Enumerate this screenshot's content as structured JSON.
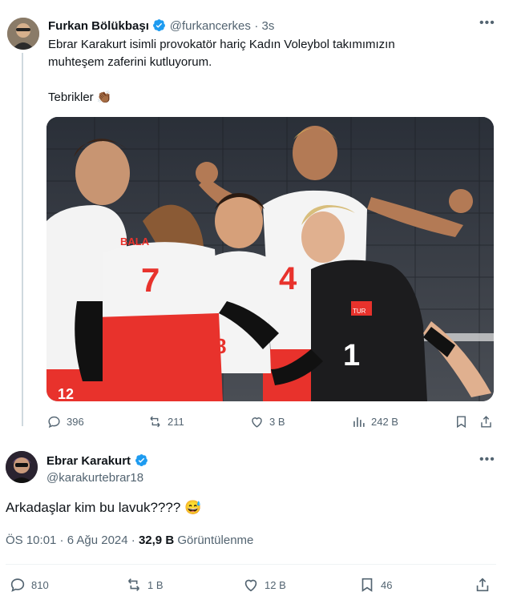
{
  "quoted_tweet": {
    "author_name": "Furkan Bölükbaşı",
    "handle": "@furkancerkes",
    "time": "· 3s",
    "text_line1": "Ebrar Karakurt isimli provokatör hariç Kadın Voleybol takımımızın",
    "text_line2": "muhteşem zaferini kutluyorum.",
    "text_line3": "Tebrikler",
    "emoji": "👏🏾",
    "jersey_numbers": [
      "7",
      "4",
      "1",
      "8",
      "12"
    ],
    "jersey_text": "BALA",
    "flag_text": "TUR",
    "actions": {
      "replies": "396",
      "retweets": "211",
      "likes": "3 B",
      "views": "242 B"
    }
  },
  "main_tweet": {
    "author_name": "Ebrar Karakurt",
    "handle": "@karakurtebrar18",
    "text": "Arkadaşlar kim bu lavuk????",
    "emoji": "😅",
    "time": "ÖS 10:01 · 6 Ağu 2024 ·",
    "view_count": "32,9 B",
    "view_label": "Görüntülenme",
    "actions": {
      "replies": "810",
      "retweets": "1 B",
      "likes": "12 B",
      "bookmarks": "46"
    }
  },
  "colors": {
    "verified": "#1d9bf0",
    "muted": "#536471",
    "text": "#0f1419",
    "divider": "#eff3f4",
    "thread_line": "#cfd9de"
  }
}
